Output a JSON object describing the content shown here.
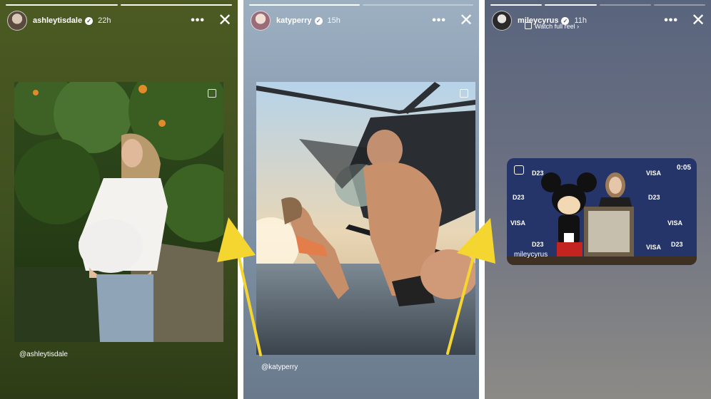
{
  "stories": [
    {
      "username": "ashleytisdale",
      "time": "22h",
      "mention": "@ashleytisdale",
      "progress_segments": 2,
      "active_segments": 2
    },
    {
      "username": "katyperry",
      "time": "15h",
      "mention": "@katyperry",
      "progress_segments": 2,
      "active_segments": 1
    },
    {
      "username": "mileycyrus",
      "time": "11h",
      "subtitle": "Watch full reel ›",
      "reel": {
        "duration": "0:05",
        "username": "mileycyrus",
        "backdrop_texts": [
          "VISA",
          "D23"
        ]
      },
      "progress_segments": 4,
      "active_segments": 2
    }
  ],
  "icons": {
    "more": "more-horizontal-icon",
    "close": "close-icon",
    "verified": "verified-badge-icon",
    "reel": "reel-icon",
    "multi_photo": "multi-photo-icon"
  },
  "colors": {
    "arrow": "#f5d631",
    "text": "#ffffff"
  }
}
